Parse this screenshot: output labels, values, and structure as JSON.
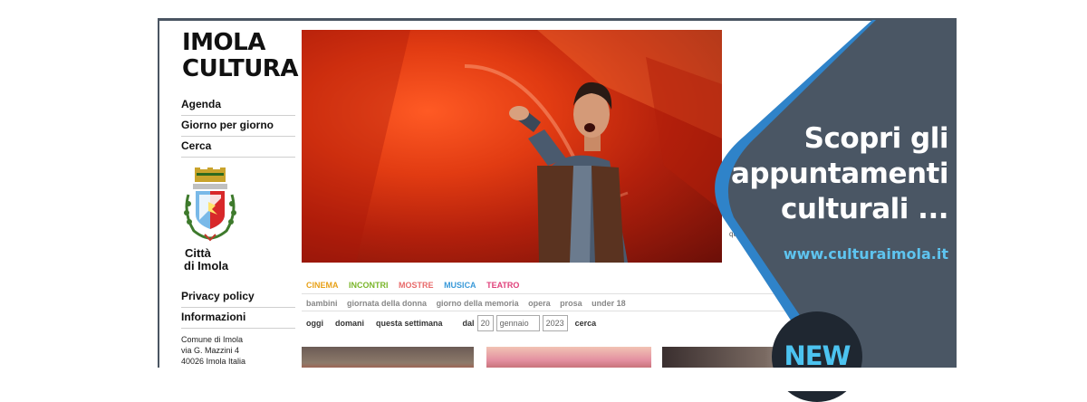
{
  "site": {
    "logo_line1": "IMOLA",
    "logo_line2": "CULTURA"
  },
  "nav": [
    {
      "label": "Agenda"
    },
    {
      "label": "Giorno per giorno"
    },
    {
      "label": "Cerca"
    }
  ],
  "city": {
    "line1": "Città",
    "line2": "di Imola"
  },
  "nav_secondary": [
    {
      "label": "Privacy policy"
    },
    {
      "label": "Informazioni"
    }
  ],
  "address": {
    "line1": "Comune di Imola",
    "line2": "via G. Mazzini 4",
    "line3": "40026 Imola Italia"
  },
  "categories": [
    {
      "label": "CINEMA",
      "color": "#e8a21a"
    },
    {
      "label": "INCONTRI",
      "color": "#7ab52a"
    },
    {
      "label": "MOSTRE",
      "color": "#e86a6a"
    },
    {
      "label": "MUSICA",
      "color": "#3a9ad9"
    },
    {
      "label": "TEATRO",
      "color": "#e0407a"
    }
  ],
  "subcategories": [
    {
      "label": "bambini"
    },
    {
      "label": "giornata della donna"
    },
    {
      "label": "giorno della memoria"
    },
    {
      "label": "opera"
    },
    {
      "label": "prosa"
    },
    {
      "label": "under 18"
    }
  ],
  "date_filter": {
    "today": "oggi",
    "tomorrow": "domani",
    "this_week": "questa settimana",
    "from": "dal",
    "day": "20",
    "month": "gennaio",
    "year": "2023",
    "search": "cerca"
  },
  "hero_caption_fragment": "qu",
  "promo": {
    "headline_line1": "Scopri gli",
    "headline_line2": "appuntamenti",
    "headline_line3": "culturali ...",
    "url": "www.culturaimola.it",
    "badge": "NEW"
  },
  "colors": {
    "panel": "#4a5664",
    "panel_accent": "#2f83c9",
    "url": "#5ec4ef",
    "badge": "#1f2731"
  }
}
